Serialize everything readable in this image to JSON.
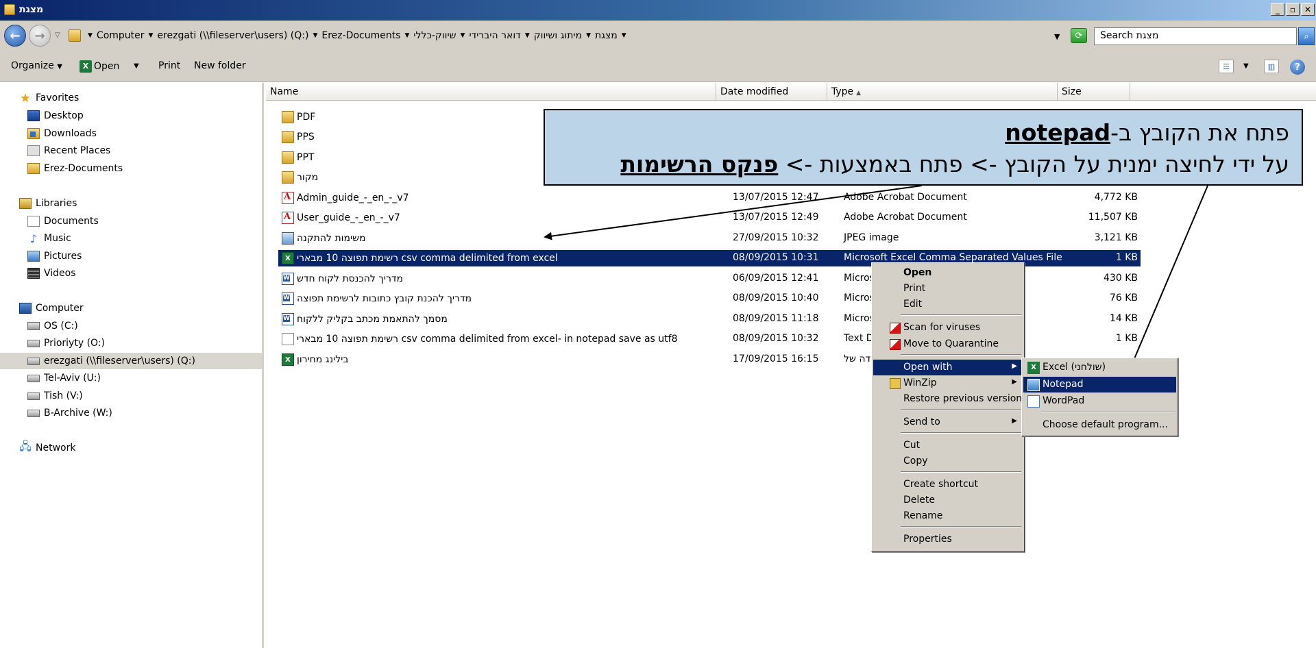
{
  "window": {
    "title": "מצגת"
  },
  "address": {
    "crumbs": [
      "Computer",
      "erezgati (\\\\fileserver\\users) (Q:)",
      "Erez-Documents",
      "שיווק-כללי",
      "דואר היברידי",
      "מיתוג ושיווק",
      "מצגת"
    ],
    "search_placeholder": "Search מצגת"
  },
  "toolbar": {
    "organize": "Organize",
    "open": "Open",
    "print": "Print",
    "new_folder": "New folder"
  },
  "nav": {
    "favorites": "Favorites",
    "desktop": "Desktop",
    "downloads": "Downloads",
    "recent": "Recent Places",
    "erez_docs": "Erez-Documents",
    "libraries": "Libraries",
    "documents": "Documents",
    "music": "Music",
    "pictures": "Pictures",
    "videos": "Videos",
    "computer": "Computer",
    "os_c": "OS (C:)",
    "priority_o": "Prioriyty (O:)",
    "erezgati_q": "erezgati (\\\\fileserver\\users) (Q:)",
    "telaviv_u": "Tel-Aviv (U:)",
    "tish_v": "Tish (V:)",
    "barchive_w": "B-Archive (W:)",
    "network": "Network"
  },
  "columns": {
    "name": "Name",
    "date": "Date modified",
    "type": "Type",
    "size": "Size"
  },
  "files": [
    {
      "name": "PDF",
      "date": "",
      "type": "",
      "size": ""
    },
    {
      "name": "PPS",
      "date": "",
      "type": "",
      "size": ""
    },
    {
      "name": "PPT",
      "date": "",
      "type": "",
      "size": ""
    },
    {
      "name": "מקור",
      "date": "",
      "type": "",
      "size": ""
    },
    {
      "name": "Admin_guide_-_en_-_v7",
      "date": "13/07/2015 12:47",
      "type": "Adobe Acrobat Document",
      "size": "4,772 KB"
    },
    {
      "name": "User_guide_-_en_-_v7",
      "date": "13/07/2015 12:49",
      "type": "Adobe Acrobat Document",
      "size": "11,507 KB"
    },
    {
      "name": "משימות להתקנה",
      "date": "27/09/2015 10:32",
      "type": "JPEG image",
      "size": "3,121 KB"
    },
    {
      "name": "רשימת תפוצה 10 מבארי csv comma delimited from excel",
      "date": "08/09/2015 10:31",
      "type": "Microsoft Excel Comma Separated Values File",
      "size": "1 KB"
    },
    {
      "name": "מדריך להכנסת לקוח חדש",
      "date": "06/09/2015 12:41",
      "type": "Microsoft",
      "size": "430 KB"
    },
    {
      "name": "מדריך להכנת קובץ כתובות לרשימת תפוצה",
      "date": "08/09/2015 10:40",
      "type": "Microsoft",
      "size": "76 KB"
    },
    {
      "name": "מסמך להתאמת מכתב בקליק ללקוח",
      "date": "08/09/2015 11:18",
      "type": "Microsoft",
      "size": "14 KB"
    },
    {
      "name": "רשימת תפוצה 10 מבארי csv comma delimited from excel- in notepad save as utf8",
      "date": "08/09/2015 10:32",
      "type": "Text Doc",
      "size": "1 KB"
    },
    {
      "name": "בילינג מחירון",
      "date": "17/09/2015 16:15",
      "type": "בודה של",
      "size": ""
    }
  ],
  "callout": {
    "line1_pre": "פתח את הקובץ ב-",
    "line1_bold": "notepad",
    "line2_pre": "על ידי לחיצה ימנית על הקובץ -> פתח באמצעות -> ",
    "line2_bold": "פנקס הרשימות"
  },
  "context_menu": {
    "open": "Open",
    "print": "Print",
    "edit": "Edit",
    "scan": "Scan for viruses",
    "quarantine": "Move to Quarantine",
    "open_with": "Open with",
    "winzip": "WinZip",
    "restore": "Restore previous versions",
    "send_to": "Send to",
    "cut": "Cut",
    "copy": "Copy",
    "create_shortcut": "Create shortcut",
    "delete": "Delete",
    "rename": "Rename",
    "properties": "Properties"
  },
  "submenu": {
    "excel": "Excel (שולחני)",
    "notepad": "Notepad",
    "wordpad": "WordPad",
    "choose": "Choose default program..."
  }
}
